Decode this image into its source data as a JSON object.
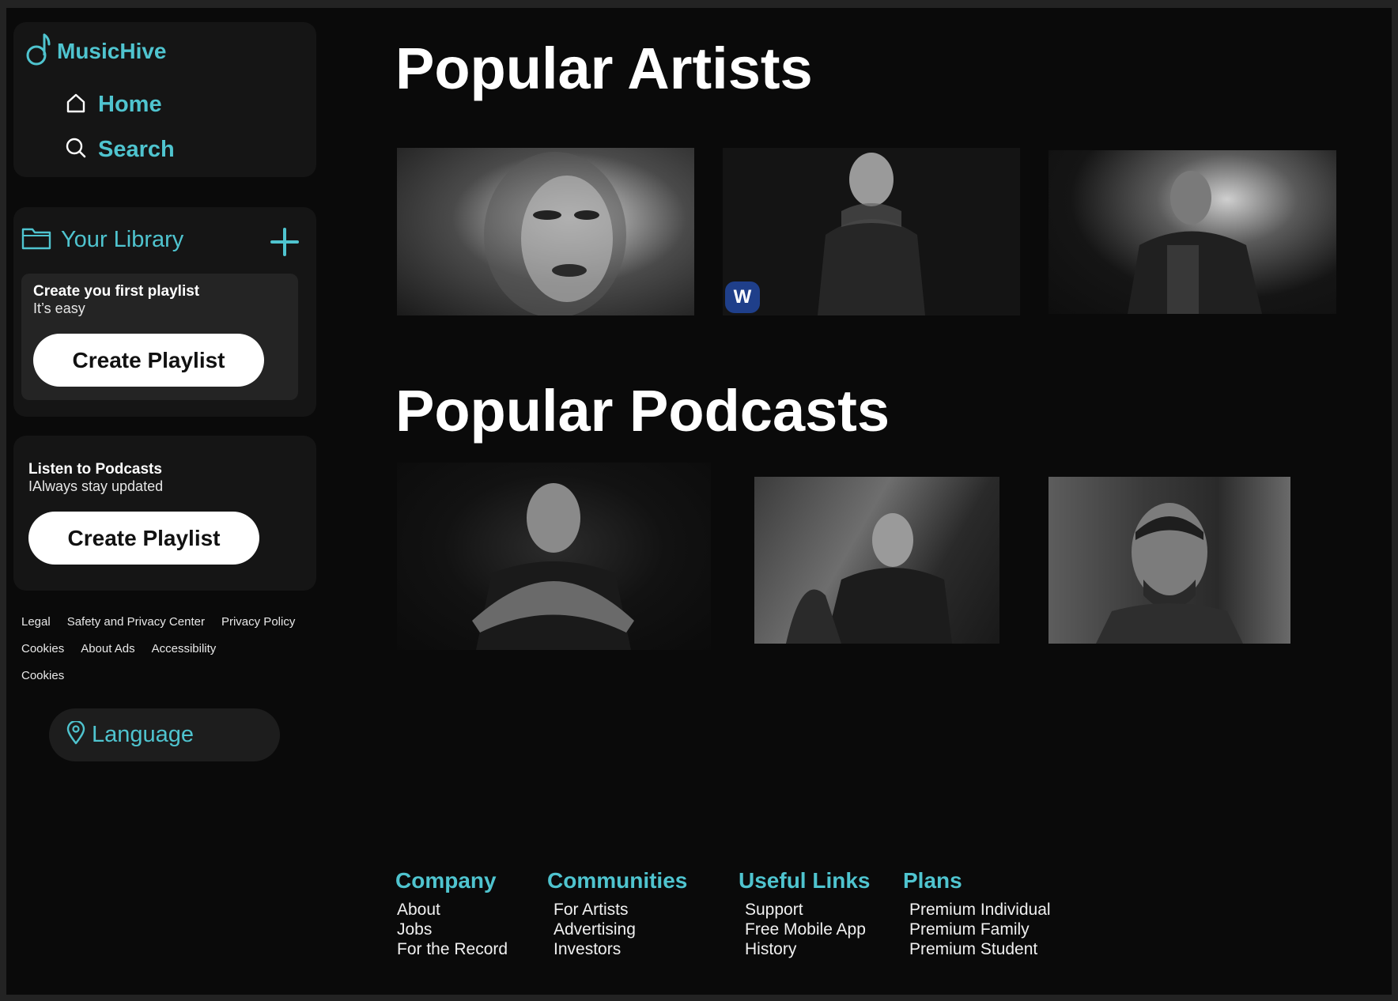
{
  "brand": {
    "name": "MusicHive"
  },
  "nav": {
    "home": "Home",
    "search": "Search"
  },
  "library": {
    "title": "Your Library",
    "card_title": "Create you first playlist",
    "card_sub": "It’s easy",
    "card_button": "Create Playlist"
  },
  "podcast_promo": {
    "title": "Listen to Podcasts",
    "sub": "IAlways stay updated",
    "button": "Create Playlist"
  },
  "legal": {
    "row1": [
      "Legal",
      "Safety and Privacy Center",
      "Privacy Policy"
    ],
    "row2": [
      "Cookies",
      "About Ads",
      "Accessibility"
    ],
    "row3": [
      "Cookies"
    ]
  },
  "language_button": "Language",
  "main": {
    "artists_heading": "Popular Artists",
    "podcasts_heading": "Popular Podcasts",
    "badge_letter": "W"
  },
  "footer": {
    "company": {
      "title": "Company",
      "links": [
        "About",
        "Jobs",
        "For the Record"
      ]
    },
    "communities": {
      "title": "Communities",
      "links": [
        "For Artists",
        "Advertising",
        "Investors"
      ]
    },
    "useful_links": {
      "title": "Useful Links",
      "links": [
        "Support",
        "Free Mobile App",
        "History"
      ]
    },
    "plans": {
      "title": "Plans",
      "links": [
        "Premium Individual",
        "Premium Family",
        "Premium Student"
      ]
    }
  },
  "colors": {
    "accent": "#4fc4cf",
    "background": "#0a0a0a",
    "panel": "#151515"
  },
  "icons": [
    "music-note-icon",
    "home-icon",
    "search-icon",
    "folder-icon",
    "plus-icon",
    "location-pin-icon"
  ]
}
